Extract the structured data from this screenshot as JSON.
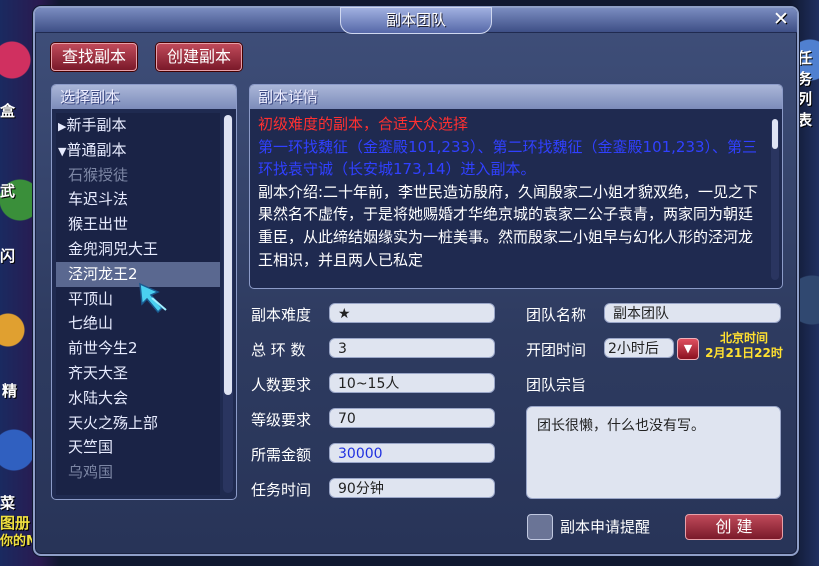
{
  "background": {
    "left_texts": [
      "盒",
      "武",
      "闪",
      "精",
      "菜",
      "图册",
      "你的M"
    ],
    "right_texts": [
      "任务",
      "列表"
    ]
  },
  "window": {
    "title": "副本团队"
  },
  "toolbar": {
    "find_label": "查找副本",
    "create_label": "创建副本"
  },
  "list_panel": {
    "header": "选择副本",
    "items": [
      {
        "label": "新手副本",
        "type": "category",
        "arrow": "▶"
      },
      {
        "label": "普通副本",
        "type": "category",
        "arrow": "▼"
      },
      {
        "label": "石猴授徒",
        "type": "disabled"
      },
      {
        "label": "车迟斗法",
        "type": "normal"
      },
      {
        "label": "猴王出世",
        "type": "normal"
      },
      {
        "label": "金兜洞兕大王",
        "type": "normal"
      },
      {
        "label": "泾河龙王2",
        "type": "selected"
      },
      {
        "label": "平顶山",
        "type": "normal"
      },
      {
        "label": "七绝山",
        "type": "normal"
      },
      {
        "label": "前世今生2",
        "type": "normal"
      },
      {
        "label": "齐天大圣",
        "type": "normal"
      },
      {
        "label": "水陆大会",
        "type": "normal"
      },
      {
        "label": "天火之殇上部",
        "type": "normal"
      },
      {
        "label": "天竺国",
        "type": "normal"
      },
      {
        "label": "乌鸡国",
        "type": "disabled"
      }
    ]
  },
  "detail_panel": {
    "header": "副本详情",
    "line_red": "初级难度的副本，合适大众选择",
    "line_blue": "第一环找魏征（金銮殿101,233）、第二环找魏征（金銮殿101,233）、第三环找袁守诚（长安城173,14）进入副本。",
    "line_intro": "副本介绍:二十年前，李世民造访殷府，久闻殷家二小姐才貌双绝，一见之下果然名不虚传，于是将她赐婚才华绝京城的袁家二公子袁青，两家同为朝廷重臣，从此缔结姻缘实为一桩美事。然而殷家二小姐早与幻化人形的泾河龙王相识，并且两人已私定"
  },
  "info": {
    "difficulty_label": "副本难度",
    "difficulty_value": "★",
    "rounds_label": "总 环 数",
    "rounds_value": "3",
    "people_label": "人数要求",
    "people_value": "10~15人",
    "level_label": "等级要求",
    "level_value": "70",
    "money_label": "所需金额",
    "money_value": "30000",
    "time_label": "任务时间",
    "time_value": "90分钟"
  },
  "team": {
    "name_label": "团队名称",
    "name_value": "副本团队",
    "open_label": "开团时间",
    "open_value": "2小时后",
    "beijing_label": "北京时间",
    "beijing_value": "2月21日22时",
    "purpose_label": "团队宗旨",
    "purpose_value": "团长很懒，什么也没有写。",
    "reminder_label": "副本申请提醒",
    "create_btn": "创 建"
  }
}
